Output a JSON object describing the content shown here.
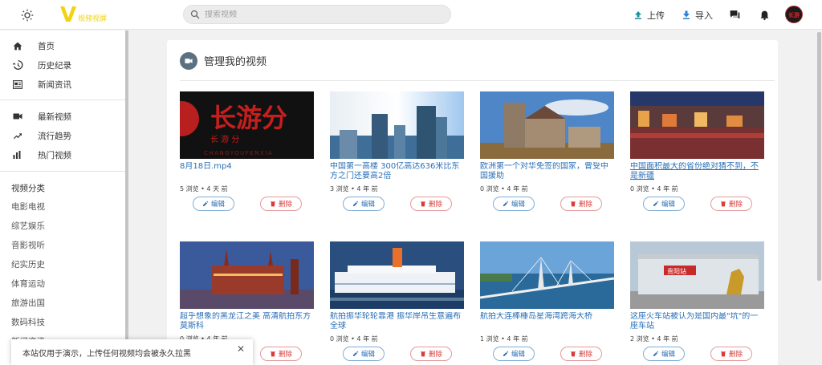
{
  "header": {
    "logo_letter": "V",
    "logo_text": "视频视屏",
    "search_placeholder": "搜索视频",
    "upload_label": "上传",
    "import_label": "导入",
    "avatar_text": "长游"
  },
  "sidebar": {
    "main_items": [
      {
        "label": "首页",
        "icon": "home-icon"
      },
      {
        "label": "历史纪录",
        "icon": "history-icon"
      },
      {
        "label": "新闻资讯",
        "icon": "news-icon"
      }
    ],
    "video_items": [
      {
        "label": "最新视频",
        "icon": "videocam-icon"
      },
      {
        "label": "流行趋势",
        "icon": "trending-icon"
      },
      {
        "label": "热门视频",
        "icon": "bar-chart-icon"
      }
    ],
    "category_heading": "视频分类",
    "categories": [
      "电影电视",
      "综艺娱乐",
      "音影视听",
      "纪实历史",
      "体育运动",
      "旅游出国",
      "数码科技",
      "新闻资讯"
    ]
  },
  "main": {
    "title": "管理我的视频",
    "edit_label": "编辑",
    "delete_label": "删除",
    "videos": [
      {
        "title": "8月18日.mp4",
        "meta": "5 浏览 • 4 天 前",
        "thumb": "changyou"
      },
      {
        "title": "中国第一高楼 300亿高达636米比东方之门还要高2倍",
        "meta": "3 浏览 • 4 年 前",
        "thumb": "skyscraper"
      },
      {
        "title": "欧洲第一个对华免签的国家，曾受中国援助",
        "meta": "0 浏览 • 4 年 前",
        "thumb": "castle"
      },
      {
        "title": "中国面积最大的省份绝对猜不到，不是新疆",
        "meta": "0 浏览 • 4 年 前",
        "thumb": "river-town"
      },
      {
        "title": "超乎想象的黑龙江之美 高清航拍东方莫斯科",
        "meta": "0 浏览 • 4 年 前",
        "thumb": "cathedral"
      },
      {
        "title": "航拍振华轮轮靠港 振华岸吊生意遍布全球",
        "meta": "0 浏览 • 4 年 前",
        "thumb": "cruise"
      },
      {
        "title": "航拍大连棒棰岛星海湾跨海大桥",
        "meta": "1 浏览 • 4 年 前",
        "thumb": "bridge"
      },
      {
        "title": "这座火车站被认为是国内最\"坑\"的一座车站",
        "meta": "2 浏览 • 4 年 前",
        "thumb": "station"
      }
    ]
  },
  "thumb_text": {
    "changyou_big": "长游分",
    "changyou_small": "长 游 分",
    "changyou_pinyin": "CHANGYOUFENXIA",
    "station_sign": "贵阳站"
  },
  "toast": {
    "message": "本站仅用于演示，上传任何视频均会被永久拉黑",
    "close": "✕"
  },
  "colors": {
    "logo": "#f0d314",
    "link": "#2a6fb6",
    "delete": "#d93a3a"
  }
}
